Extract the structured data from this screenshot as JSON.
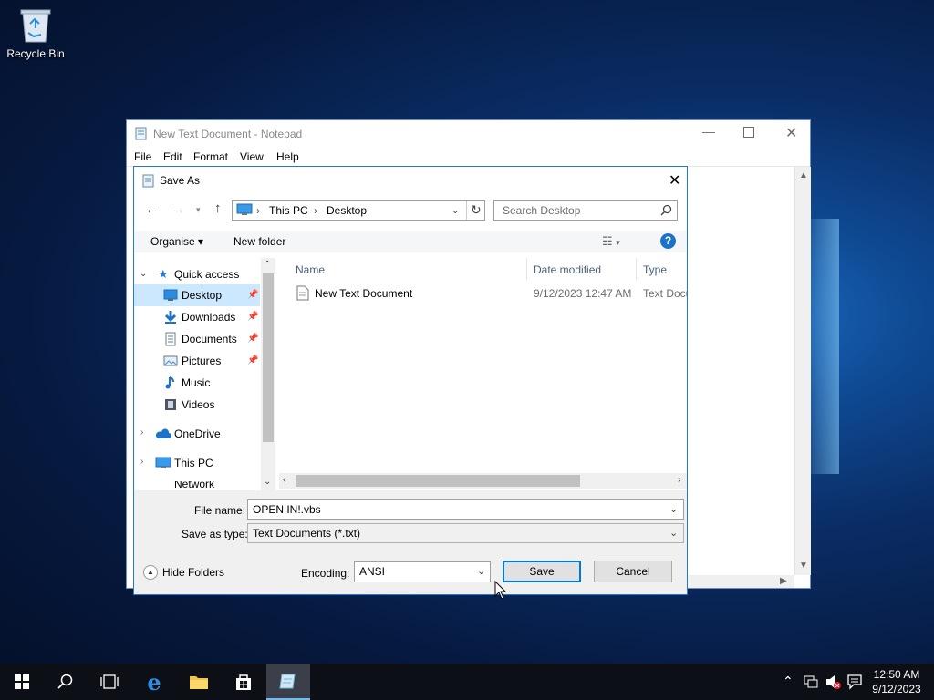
{
  "desktop": {
    "recycle_bin_label": "Recycle Bin"
  },
  "notepad": {
    "title": "New Text Document - Notepad",
    "menu": [
      "File",
      "Edit",
      "Format",
      "View",
      "Help"
    ]
  },
  "dialog": {
    "title": "Save As",
    "breadcrumb": [
      "This PC",
      "Desktop"
    ],
    "search_placeholder": "Search Desktop",
    "toolbar": {
      "organise": "Organise",
      "new_folder": "New folder"
    },
    "nav": {
      "quick_access": "Quick access",
      "items": [
        {
          "label": "Desktop",
          "icon": "desktop-icon",
          "pinned": true,
          "selected": true
        },
        {
          "label": "Downloads",
          "icon": "downloads-icon",
          "pinned": true
        },
        {
          "label": "Documents",
          "icon": "documents-icon",
          "pinned": true
        },
        {
          "label": "Pictures",
          "icon": "pictures-icon",
          "pinned": true
        },
        {
          "label": "Music",
          "icon": "music-icon",
          "pinned": false
        },
        {
          "label": "Videos",
          "icon": "videos-icon",
          "pinned": false
        }
      ],
      "onedrive": "OneDrive",
      "this_pc": "This PC",
      "network": "Network"
    },
    "columns": {
      "name": "Name",
      "date_modified": "Date modified",
      "type": "Type"
    },
    "files": [
      {
        "name": "New Text Document",
        "date_modified": "9/12/2023 12:47 AM",
        "type": "Text Document"
      }
    ],
    "file_name_label": "File name:",
    "file_name_value": "OPEN IN!.vbs",
    "save_as_type_label": "Save as type:",
    "save_as_type_value": "Text Documents (*.txt)",
    "hide_folders": "Hide Folders",
    "encoding_label": "Encoding:",
    "encoding_value": "ANSI",
    "save_button": "Save",
    "cancel_button": "Cancel"
  },
  "taskbar": {
    "time": "12:50 AM",
    "date": "9/12/2023"
  },
  "colors": {
    "accent": "#0078d7",
    "selection": "#cce8ff",
    "taskbar": "#0c0f16"
  }
}
